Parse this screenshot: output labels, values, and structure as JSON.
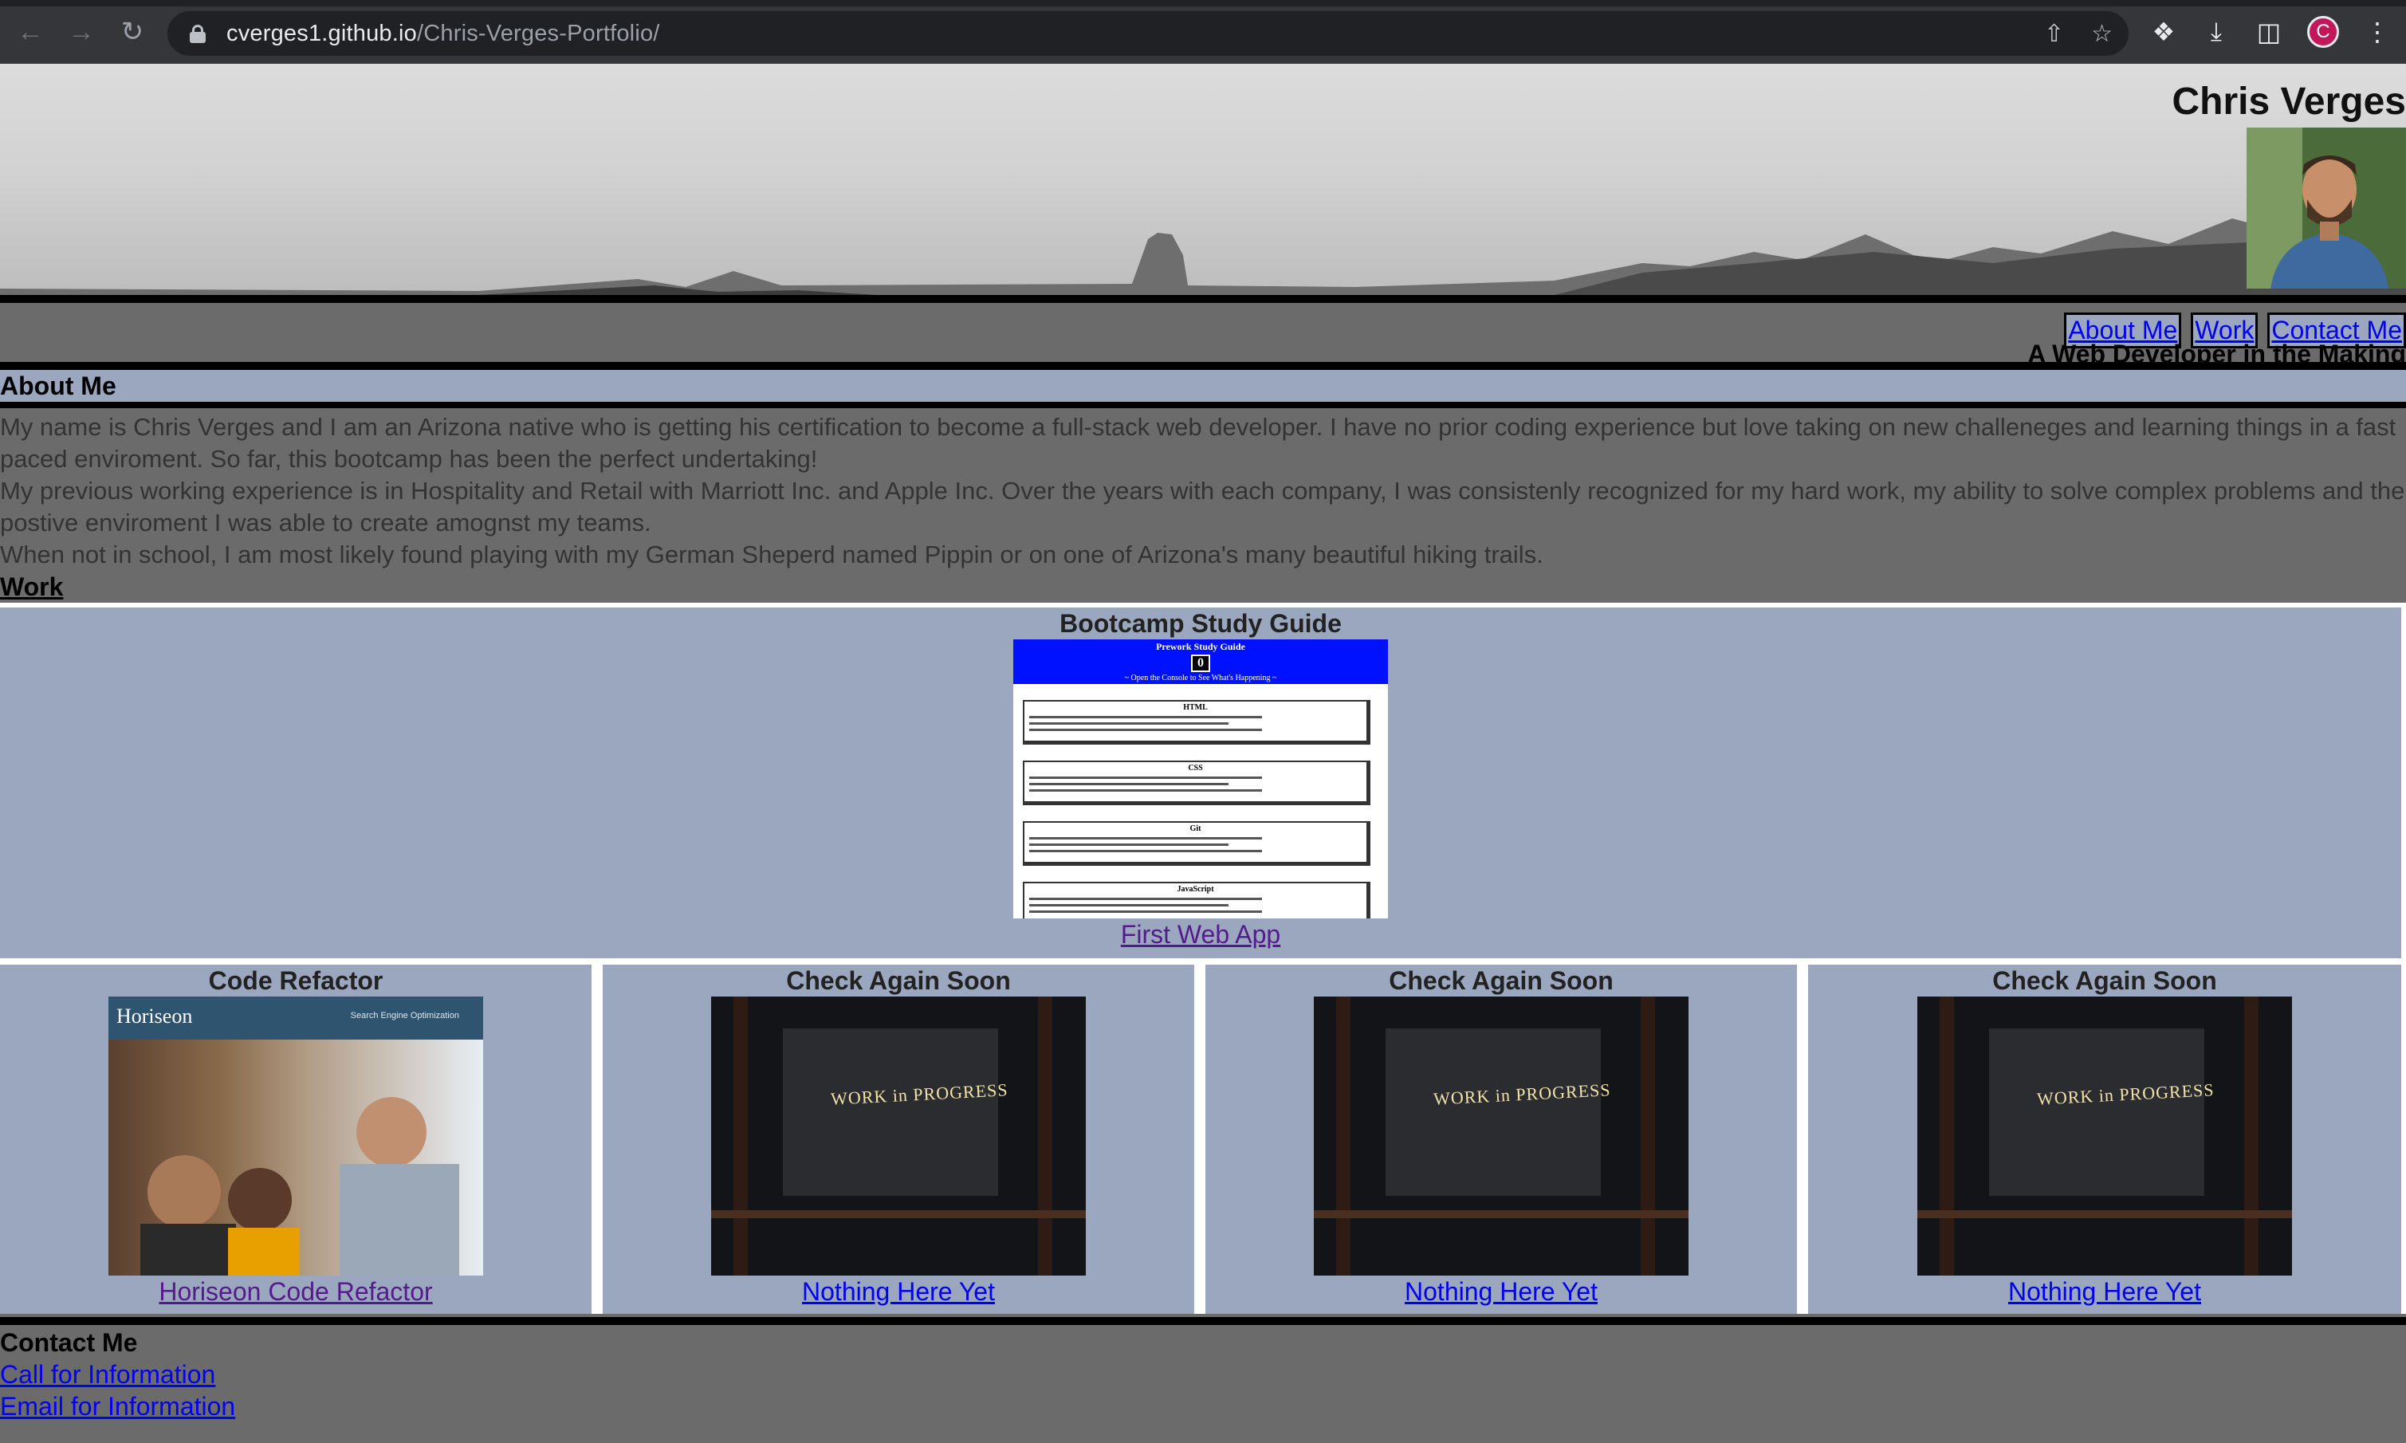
{
  "browser": {
    "url_domain": "cverges1.github.io",
    "url_path": "/Chris-Verges-Portfolio/",
    "profile_initial": "C"
  },
  "header": {
    "name": "Chris Verges",
    "nav": [
      "About Me",
      "Work",
      "Contact Me"
    ],
    "tagline": "A Web Developer in the Making"
  },
  "about": {
    "heading": "About Me",
    "paragraphs": [
      "My name is Chris Verges and I am an Arizona native who is getting his certification to become a full-stack web developer. I have no prior coding experience but love taking on new challeneges and learning things in a fast paced enviroment. So far, this bootcamp has been the perfect undertaking!",
      "My previous working experience is in Hospitality and Retail with Marriott Inc. and Apple Inc. Over the years with each company, I was consistenly recognized for my hard work, my ability to solve complex problems and the postive enviroment I was able to create amognst my teams.",
      "When not in school, I am most likely found playing with my German Sheperd named Pippin or on one of Arizona's many beautiful hiking trails."
    ]
  },
  "work": {
    "heading": "Work",
    "featured": {
      "title": "Bootcamp Study Guide",
      "link": "First Web App",
      "preview": {
        "title": "Prework Study Guide",
        "counter": "0",
        "subtitle": "~ Open the Console to See What's Happening ~",
        "boxes": [
          "HTML",
          "CSS",
          "Git",
          "JavaScript"
        ]
      }
    },
    "cards": [
      {
        "title": "Code Refactor",
        "link": "Horiseon Code Refactor",
        "thumb": {
          "logo": "Horiseon",
          "nav": "Search Engine Optimization"
        }
      },
      {
        "title": "Check Again Soon",
        "link": "Nothing Here Yet",
        "thumb": {
          "sign": "WORK in PROGRESS"
        }
      },
      {
        "title": "Check Again Soon",
        "link": "Nothing Here Yet",
        "thumb": {
          "sign": "WORK in PROGRESS"
        }
      },
      {
        "title": "Check Again Soon",
        "link": "Nothing Here Yet",
        "thumb": {
          "sign": "WORK in PROGRESS"
        }
      }
    ]
  },
  "contact": {
    "heading": "Contact Me",
    "links": [
      "Call for Information",
      "Email for Information"
    ]
  },
  "colors": {
    "section_bg": "#9aa7bf",
    "page_bg": "#6b6b6b",
    "link": "#0000ee",
    "visited_link": "#551a8b"
  }
}
